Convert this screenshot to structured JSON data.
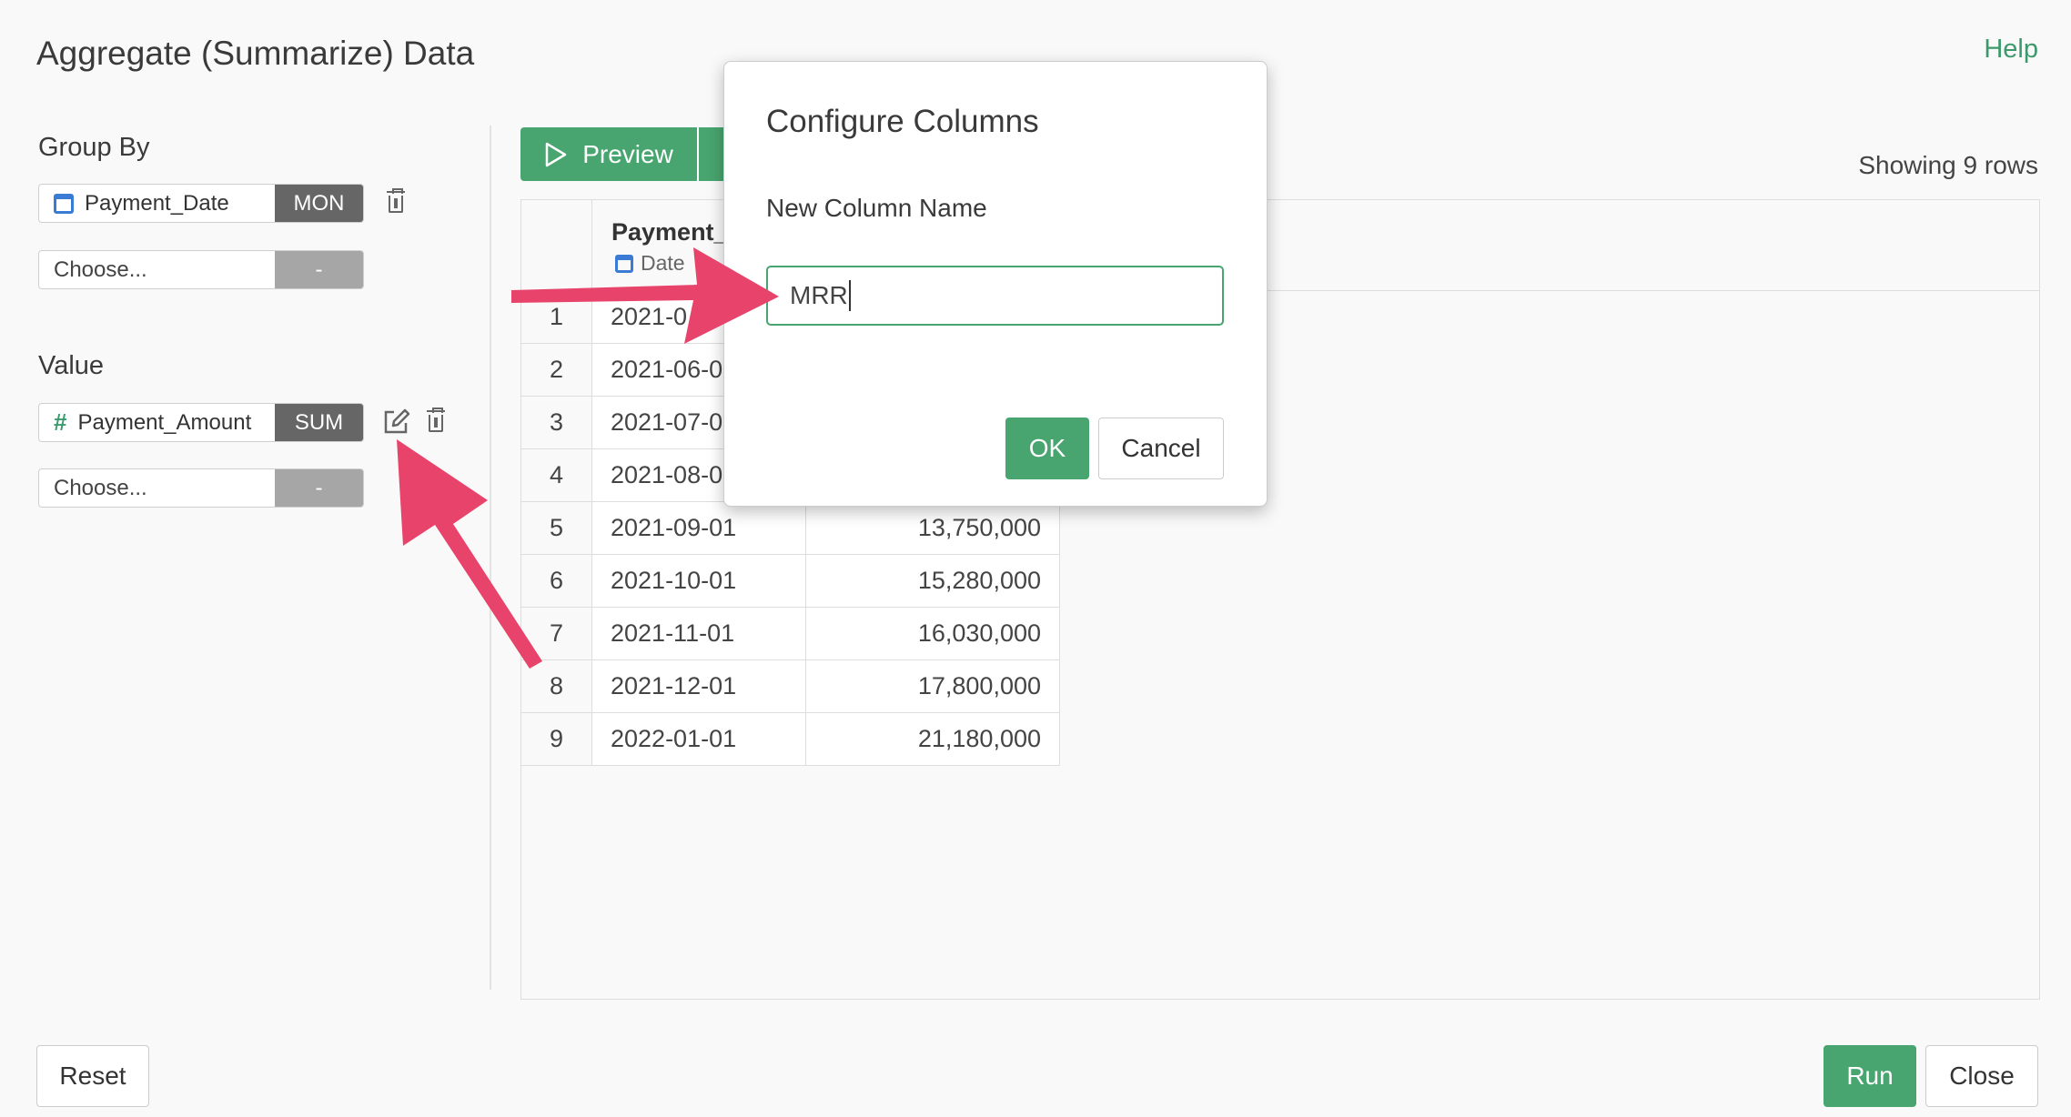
{
  "header": {
    "title": "Aggregate (Summarize) Data",
    "help_label": "Help"
  },
  "group_by": {
    "label": "Group By",
    "field": {
      "name": "Payment_Date",
      "agg": "MON",
      "icon": "calendar-icon"
    },
    "empty": {
      "placeholder": "Choose...",
      "agg": "-"
    }
  },
  "value": {
    "label": "Value",
    "field": {
      "name": "Payment_Amount",
      "agg": "SUM",
      "icon": "hash-icon"
    },
    "empty": {
      "placeholder": "Choose...",
      "agg": "-"
    }
  },
  "toolbar": {
    "preview_label": "Preview",
    "showing_text": "Showing 9 rows"
  },
  "table": {
    "column_name": "Payment_",
    "column_type": "Date",
    "rows": [
      {
        "idx": "1",
        "date": "2021-0",
        "amount": ""
      },
      {
        "idx": "2",
        "date": "2021-06-0",
        "amount": ""
      },
      {
        "idx": "3",
        "date": "2021-07-0",
        "amount": ""
      },
      {
        "idx": "4",
        "date": "2021-08-0",
        "amount": ""
      },
      {
        "idx": "5",
        "date": "2021-09-01",
        "amount": "13,750,000"
      },
      {
        "idx": "6",
        "date": "2021-10-01",
        "amount": "15,280,000"
      },
      {
        "idx": "7",
        "date": "2021-11-01",
        "amount": "16,030,000"
      },
      {
        "idx": "8",
        "date": "2021-12-01",
        "amount": "17,800,000"
      },
      {
        "idx": "9",
        "date": "2022-01-01",
        "amount": "21,180,000"
      }
    ]
  },
  "dialog": {
    "title": "Configure Columns",
    "field_label": "New Column Name",
    "field_value": "MRR",
    "ok_label": "OK",
    "cancel_label": "Cancel"
  },
  "footer": {
    "reset_label": "Reset",
    "run_label": "Run",
    "close_label": "Close"
  },
  "colors": {
    "accent": "#48a56f",
    "annotation_arrow": "#e8446b",
    "agg_chip": "#666666"
  }
}
